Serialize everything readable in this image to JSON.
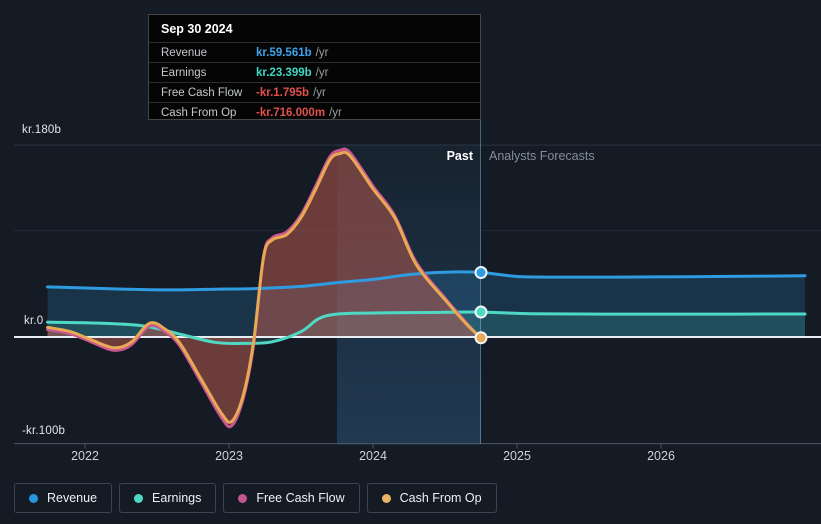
{
  "tooltip": {
    "date": "Sep 30 2024",
    "rows": [
      {
        "label": "Revenue",
        "value": "kr.59.561b",
        "suffix": "/yr",
        "color": "#3aa4ec"
      },
      {
        "label": "Earnings",
        "value": "kr.23.399b",
        "suffix": "/yr",
        "color": "#3ed8c3"
      },
      {
        "label": "Free Cash Flow",
        "value": "-kr.1.795b",
        "suffix": "/yr",
        "color": "#e0504c"
      },
      {
        "label": "Cash From Op",
        "value": "-kr.716.000m",
        "suffix": "/yr",
        "color": "#e0504c"
      }
    ]
  },
  "chart": {
    "past_label": "Past",
    "forecast_label": "Analysts Forecasts"
  },
  "legend": {
    "items": [
      {
        "label": "Revenue",
        "color": "#2596df"
      },
      {
        "label": "Earnings",
        "color": "#4fd9c5"
      },
      {
        "label": "Free Cash Flow",
        "color": "#c2568d"
      },
      {
        "label": "Cash From Op",
        "color": "#eab263"
      }
    ]
  },
  "chart_data": {
    "type": "area",
    "y_unit": "kr billions",
    "ylim": [
      -100,
      180
    ],
    "xlim": [
      2021.74,
      2027.02
    ],
    "grid": "horizontal",
    "highlight_range": [
      2023.75,
      2024.75
    ],
    "past_boundary_x": 2024.75,
    "yticks": [
      {
        "value": 180,
        "label": "kr.180b"
      },
      {
        "value": 0,
        "label": "kr.0"
      },
      {
        "value": -100,
        "label": "-kr.100b"
      }
    ],
    "xticks": [
      {
        "value": 2022,
        "label": "2022"
      },
      {
        "value": 2023,
        "label": "2023"
      },
      {
        "value": 2024,
        "label": "2024"
      },
      {
        "value": 2025,
        "label": "2025"
      },
      {
        "value": 2026,
        "label": "2026"
      }
    ],
    "series": [
      {
        "name": "Revenue",
        "color": "#2f9be0",
        "fill": "rgba(47,155,224,0.20)",
        "points": [
          [
            2021.74,
            47
          ],
          [
            2022.0,
            46
          ],
          [
            2022.3,
            44.8
          ],
          [
            2022.6,
            44.2
          ],
          [
            2022.9,
            44.8
          ],
          [
            2023.2,
            45.5
          ],
          [
            2023.5,
            47.5
          ],
          [
            2023.75,
            51
          ],
          [
            2024.0,
            54
          ],
          [
            2024.25,
            58.5
          ],
          [
            2024.5,
            60.8
          ],
          [
            2024.75,
            60.5
          ],
          [
            2025.0,
            56.8
          ],
          [
            2025.3,
            56.2
          ],
          [
            2025.7,
            56.2
          ],
          [
            2026.2,
            56.6
          ],
          [
            2026.6,
            57
          ],
          [
            2027.0,
            57.4
          ]
        ]
      },
      {
        "name": "Earnings",
        "color": "#4fd8c4",
        "fill": "rgba(79,216,196,0.16)",
        "points": [
          [
            2021.74,
            14
          ],
          [
            2022.1,
            13
          ],
          [
            2022.4,
            10.5
          ],
          [
            2022.65,
            3
          ],
          [
            2022.9,
            -5
          ],
          [
            2023.1,
            -6
          ],
          [
            2023.3,
            -4.5
          ],
          [
            2023.5,
            5
          ],
          [
            2023.62,
            17
          ],
          [
            2023.75,
            21.5
          ],
          [
            2024.0,
            22.5
          ],
          [
            2024.4,
            23
          ],
          [
            2024.75,
            23.4
          ],
          [
            2025.1,
            21.8
          ],
          [
            2025.6,
            21.5
          ],
          [
            2026.2,
            21.5
          ],
          [
            2027.0,
            21.6
          ]
        ]
      },
      {
        "name": "Free Cash Flow",
        "color": "#c9568f",
        "fill": "rgba(185,70,95,0.30)",
        "points": [
          [
            2021.74,
            7
          ],
          [
            2021.9,
            3
          ],
          [
            2022.05,
            -5
          ],
          [
            2022.2,
            -12.5
          ],
          [
            2022.32,
            -7.5
          ],
          [
            2022.45,
            10.5
          ],
          [
            2022.56,
            4.5
          ],
          [
            2022.66,
            -8.5
          ],
          [
            2022.8,
            -41
          ],
          [
            2022.95,
            -76
          ],
          [
            2023.02,
            -83
          ],
          [
            2023.1,
            -57
          ],
          [
            2023.17,
            -8
          ],
          [
            2023.24,
            76
          ],
          [
            2023.3,
            93
          ],
          [
            2023.4,
            98.5
          ],
          [
            2023.5,
            114.5
          ],
          [
            2023.6,
            141
          ],
          [
            2023.7,
            169
          ],
          [
            2023.77,
            175
          ],
          [
            2023.84,
            173
          ],
          [
            2024.0,
            141.5
          ],
          [
            2024.15,
            114
          ],
          [
            2024.3,
            70
          ],
          [
            2024.5,
            36.5
          ],
          [
            2024.65,
            13
          ],
          [
            2024.75,
            -1.8
          ]
        ]
      },
      {
        "name": "Cash From Op",
        "color": "#e8a954",
        "fill": "rgba(200,110,70,0.30)",
        "points": [
          [
            2021.74,
            9
          ],
          [
            2021.9,
            5
          ],
          [
            2022.05,
            -3
          ],
          [
            2022.2,
            -10
          ],
          [
            2022.32,
            -5
          ],
          [
            2022.45,
            13
          ],
          [
            2022.56,
            7
          ],
          [
            2022.66,
            -6
          ],
          [
            2022.8,
            -38
          ],
          [
            2022.95,
            -72
          ],
          [
            2023.02,
            -79
          ],
          [
            2023.1,
            -54
          ],
          [
            2023.17,
            -5
          ],
          [
            2023.24,
            75
          ],
          [
            2023.3,
            91
          ],
          [
            2023.4,
            96
          ],
          [
            2023.5,
            112
          ],
          [
            2023.6,
            138
          ],
          [
            2023.7,
            166
          ],
          [
            2023.77,
            172
          ],
          [
            2023.84,
            170
          ],
          [
            2024.0,
            139
          ],
          [
            2024.15,
            112
          ],
          [
            2024.3,
            68
          ],
          [
            2024.5,
            35
          ],
          [
            2024.65,
            12
          ],
          [
            2024.75,
            -0.72
          ]
        ]
      }
    ],
    "markers": [
      {
        "series": "Revenue",
        "x": 2024.75,
        "value": 60.5
      },
      {
        "series": "Earnings",
        "x": 2024.75,
        "value": 23.4
      },
      {
        "series": "Cash From Op",
        "x": 2024.75,
        "value": -0.72
      }
    ]
  }
}
